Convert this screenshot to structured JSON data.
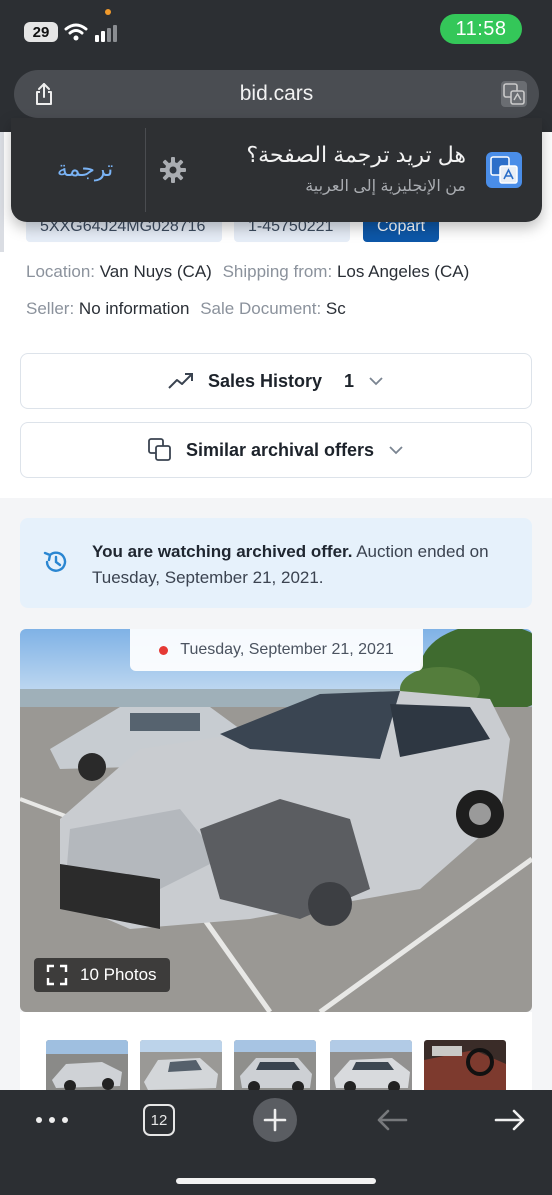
{
  "status_bar": {
    "battery": "29",
    "time": "11:58"
  },
  "url_bar": {
    "url": "bid.cars"
  },
  "translate_popup": {
    "title": "هل تريد ترجمة الصفحة؟",
    "subtitle": "من الإنجليزية إلى العربية",
    "action": "ترجمة"
  },
  "listing": {
    "vin": "5XXG64J24MG028716",
    "lot": "1-45750221",
    "auction": "Copart",
    "location_label": "Location:",
    "location": "Van Nuys (CA)",
    "shipping_label": "Shipping from:",
    "shipping": "Los Angeles (CA)",
    "seller_label": "Seller:",
    "seller": "No information",
    "sale_doc_label": "Sale Document:",
    "sale_doc": "Sc"
  },
  "sections": {
    "sales_history": "Sales History",
    "sales_history_count": "1",
    "similar_offers": "Similar archival offers"
  },
  "notice": {
    "bold": "You are watching archived offer.",
    "rest": " Auction ended on Tuesday, September 21, 2021."
  },
  "gallery": {
    "date": "Tuesday, September 21, 2021",
    "photos_label": "10 Photos"
  },
  "toolbar": {
    "tab_count": "12"
  },
  "colors": {
    "copart_blue": "#0d57a8",
    "notice_bg": "#e6f1fb",
    "time_green": "#34c759",
    "translate_link": "#7ab3f5"
  }
}
